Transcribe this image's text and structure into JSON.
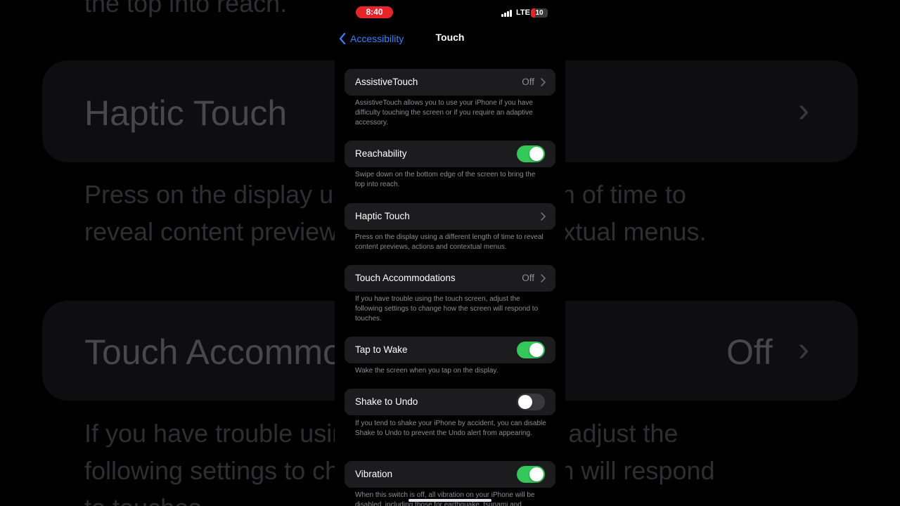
{
  "status_bar": {
    "time": "8:40",
    "network": "LTE",
    "battery": "10"
  },
  "nav": {
    "back_label": "Accessibility",
    "title": "Touch"
  },
  "settings": [
    {
      "label": "AssistiveTouch",
      "value": "Off",
      "description": "AssistiveTouch allows you to use your iPhone if you have difficulty touching the screen or if you require an adaptive accessory."
    },
    {
      "label": "Reachability",
      "toggle": true,
      "description": "Swipe down on the bottom edge of the screen to bring the top into reach."
    },
    {
      "label": "Haptic Touch",
      "description": "Press on the display using a different length of time to reveal content previews, actions and contextual menus."
    },
    {
      "label": "Touch Accommodations",
      "value": "Off",
      "description": "If you have trouble using the touch screen, adjust the following settings to change how the screen will respond to touches."
    },
    {
      "label": "Tap to Wake",
      "toggle": true,
      "description": "Wake the screen when you tap on the display."
    },
    {
      "label": "Shake to Undo",
      "toggle": false,
      "description": "If you tend to shake your iPhone by accident, you can disable Shake to Undo to prevent the Undo alert from appearing."
    },
    {
      "label": "Vibration",
      "toggle": true,
      "description": "When this switch is off, all vibration on your iPhone will be disabled, including those for earthquake, tsunami and"
    }
  ],
  "background_zoom": {
    "top_text": "the top into reach.",
    "haptic_title": "Haptic Touch",
    "haptic_line1": "Press on the display using a different length of time to",
    "haptic_line2": "reveal content previews, actions and contextual menus.",
    "touch_acc_title": "Touch Accommodations",
    "touch_acc_value": "Off",
    "touch_acc_line1": "If you have trouble using the touch screen, adjust the",
    "touch_acc_line2": "following settings to change how the screen will respond",
    "touch_acc_line3": "to touches."
  },
  "colors": {
    "accent": "#3b82f6",
    "toggle_on": "#34c759",
    "cell_bg": "#1c1c1e",
    "status_red": "#e5252a"
  }
}
